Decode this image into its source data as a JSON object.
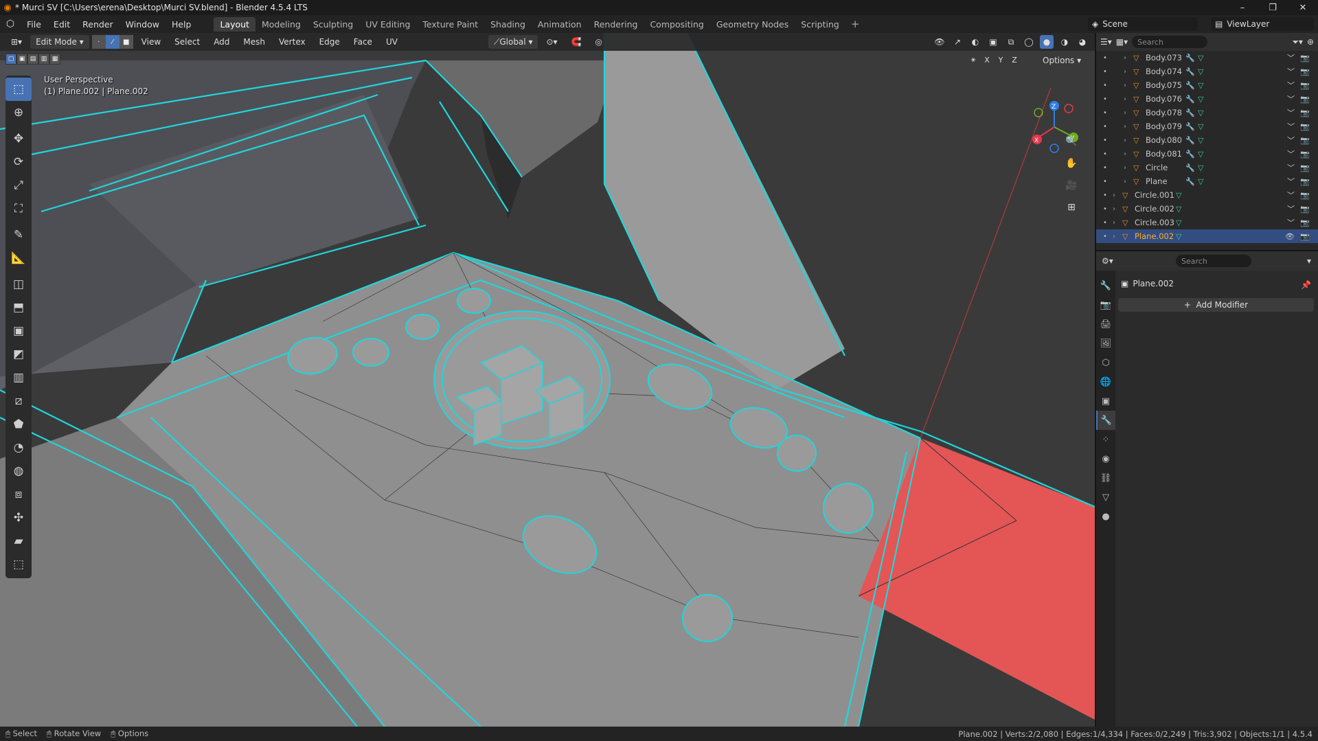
{
  "window": {
    "title": "* Murci SV [C:\\Users\\erena\\Desktop\\Murci SV.blend] - Blender 4.5.4 LTS",
    "controls": [
      "–",
      "❐",
      "✕"
    ]
  },
  "menu": {
    "items": [
      "File",
      "Edit",
      "Render",
      "Window",
      "Help"
    ],
    "workspaces": [
      "Layout",
      "Modeling",
      "Sculpting",
      "UV Editing",
      "Texture Paint",
      "Shading",
      "Animation",
      "Rendering",
      "Compositing",
      "Geometry Nodes",
      "Scripting"
    ],
    "active_workspace": "Layout",
    "scene": "Scene",
    "view_layer": "ViewLayer"
  },
  "viewport": {
    "mode": "Edit Mode",
    "menus": [
      "View",
      "Select",
      "Add",
      "Mesh",
      "Vertex",
      "Edge",
      "Face",
      "UV"
    ],
    "transform_orientation": "Global",
    "options_label": "Options",
    "axis": [
      "X",
      "Y",
      "Z"
    ],
    "info_line1": "User Perspective",
    "info_line2": "(1) Plane.002 | Plane.002",
    "gizmo": {
      "x": "X",
      "y": "Y",
      "z": "Z"
    },
    "colors": {
      "wire": "#1fd6dc",
      "face": "#8f8f8f",
      "selected_face": "#e45555",
      "background": "#3a3a3a"
    }
  },
  "outliner": {
    "search_placeholder": "Search",
    "rows": [
      {
        "name": "Body.073",
        "level": 2,
        "modifiers": true
      },
      {
        "name": "Body.074",
        "level": 2,
        "modifiers": true
      },
      {
        "name": "Body.075",
        "level": 2,
        "modifiers": true
      },
      {
        "name": "Body.076",
        "level": 2,
        "modifiers": true
      },
      {
        "name": "Body.078",
        "level": 2,
        "modifiers": true
      },
      {
        "name": "Body.079",
        "level": 2,
        "modifiers": true
      },
      {
        "name": "Body.080",
        "level": 2,
        "modifiers": true
      },
      {
        "name": "Body.081",
        "level": 2,
        "modifiers": true
      },
      {
        "name": "Circle",
        "level": 2,
        "modifiers": true
      },
      {
        "name": "Plane",
        "level": 2,
        "modifiers": true
      },
      {
        "name": "Circle.001",
        "level": 1,
        "modifiers": false
      },
      {
        "name": "Circle.002",
        "level": 1,
        "modifiers": false
      },
      {
        "name": "Circle.003",
        "level": 1,
        "modifiers": false
      },
      {
        "name": "Plane.002",
        "level": 1,
        "modifiers": false,
        "selected": true
      }
    ]
  },
  "properties": {
    "search_placeholder": "Search",
    "object_name": "Plane.002",
    "add_modifier": "Add Modifier"
  },
  "status": {
    "select": "Select",
    "rotate": "Rotate View",
    "options": "Options",
    "stats": "Plane.002 | Verts:2/2,080 | Edges:1/4,334 | Faces:0/2,249 | Tris:3,902 | Objects:1/1 | 4.5.4"
  }
}
